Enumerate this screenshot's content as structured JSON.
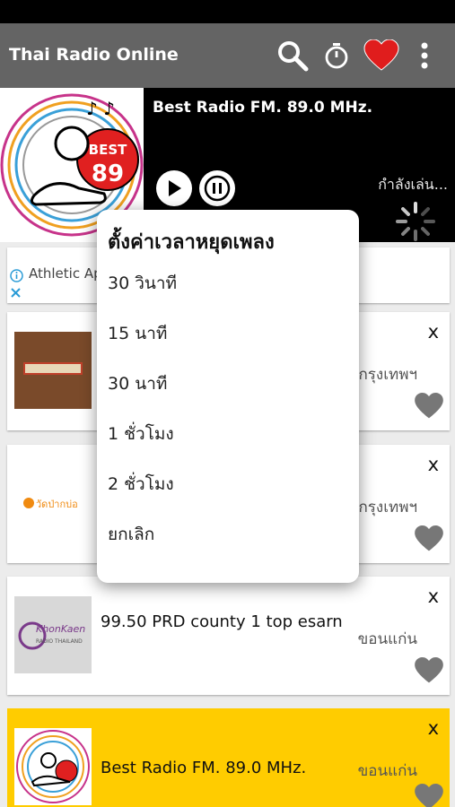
{
  "app": {
    "title": "Thai Radio Online"
  },
  "player": {
    "station_title": "Best Radio FM. 89.0 MHz.",
    "status": "กำลังเล่น...",
    "logo_text": "BEST",
    "logo_number": "89"
  },
  "ad": {
    "text": "Athletic Ap"
  },
  "dialog": {
    "title": "ตั้งค่าเวลาหยุดเพลง",
    "items": [
      "30 วินาที",
      "15 นาที",
      "30 นาที",
      "1 ชั่วโมง",
      "2 ชั่วโมง",
      "ยกเลิก"
    ]
  },
  "stations": [
    {
      "name": "",
      "location": "กรุงเทพฯ",
      "remove": "x"
    },
    {
      "name": "",
      "location": "กรุงเทพฯ",
      "remove": "x",
      "logo_text": "วัดป่ากบ่อ"
    },
    {
      "name": "99.50 PRD county 1 top esarn",
      "location": "ขอนแก่น",
      "remove": "x",
      "logo_text": "KhonKaen",
      "logo_sub": "RADIO THAILAND"
    },
    {
      "name": "Best Radio FM. 89.0 MHz.",
      "location": "ขอนแก่น",
      "remove": "x",
      "highlight": "#ffcc00"
    }
  ],
  "colors": {
    "app_bar": "#646464",
    "accent_heart": "#e01d1d",
    "highlight": "#ffcc00",
    "fav_heart": "#777777"
  }
}
